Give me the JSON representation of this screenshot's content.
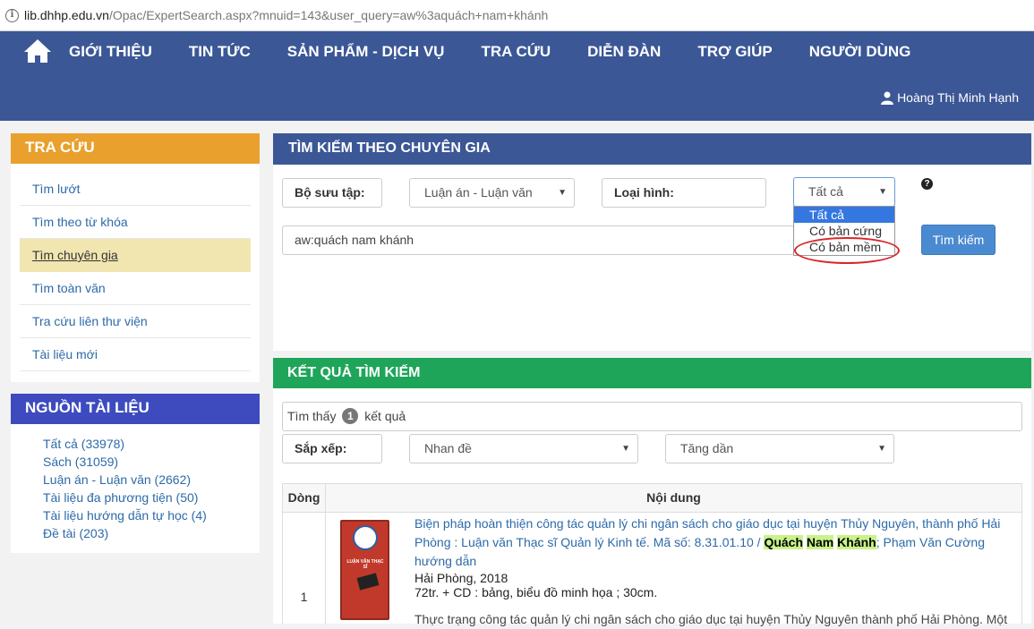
{
  "browser": {
    "url_domain": "lib.dhhp.edu.vn",
    "url_rest": "/Opac/ExpertSearch.aspx?mnuid=143&user_query=aw%3aquách+nam+khánh"
  },
  "nav": {
    "items": [
      "GIỚI THIỆU",
      "TIN TỨC",
      "SẢN PHẨM - DỊCH VỤ",
      "TRA CỨU",
      "DIỄN ĐÀN",
      "TRỢ GIÚP",
      "NGƯỜI DÙNG"
    ],
    "user": "Hoàng Thị Minh Hạnh"
  },
  "sidebar": {
    "tracuu_title": "TRA CỨU",
    "tracuu_items": [
      "Tìm lướt",
      "Tìm theo từ khóa",
      "Tìm chuyên gia",
      "Tìm toàn văn",
      "Tra cứu liên thư viện",
      "Tài liệu mới"
    ],
    "nguon_title": "NGUỒN TÀI LIỆU",
    "nguon_items": [
      "Tất cả (33978)",
      "Sách (31059)",
      "Luận án - Luận văn (2662)",
      "Tài liệu đa phương tiện (50)",
      "Tài liệu hướng dẫn tự học (4)",
      "Đề tài (203)"
    ]
  },
  "expert": {
    "title": "TÌM KIẾM THEO CHUYÊN GIA",
    "collection_label": "Bộ sưu tập:",
    "collection_value": "Luận án - Luận văn",
    "type_label": "Loại hình:",
    "type_value": "Tất cả",
    "type_options": [
      "Tất cả",
      "Có bản cứng",
      "Có bản mềm"
    ],
    "query": "aw:quách nam khánh",
    "search_button": "Tìm kiếm",
    "help": "?"
  },
  "results": {
    "title": "KẾT QUẢ TÌM KIẾM",
    "found_prefix": "Tìm thấy",
    "count": "1",
    "found_suffix": "kết quả",
    "sort_label": "Sắp xếp:",
    "sort_by": "Nhan đề",
    "sort_order": "Tăng dần",
    "col_row": "Dòng",
    "col_content": "Nội dung",
    "row_number": "1",
    "record_title": "Biện pháp hoàn thiện công tác quản lý chi ngân sách cho giáo dục tại huyện Thủy Nguyên, thành phố Hải Phòng : Luận văn Thạc sĩ Quản lý Kinh tế. Mã số: 8.31.01.10 / ",
    "author_1": "Quách",
    "author_2": "Nam",
    "author_3": "Khánh",
    "record_coauthor": "; Phạm Văn Cường hướng dẫn",
    "publication": "Hải Phòng, 2018",
    "physical": "72tr. + CD : bảng, biểu đồ minh họa ; 30cm.",
    "abstract": "Thực trạng công tác quản lý chi ngân sách cho giáo dục tại huyện Thủy Nguyên thành phố Hải Phòng. Một",
    "book_cover_text": "LUẬN VĂN THẠC SĨ"
  }
}
